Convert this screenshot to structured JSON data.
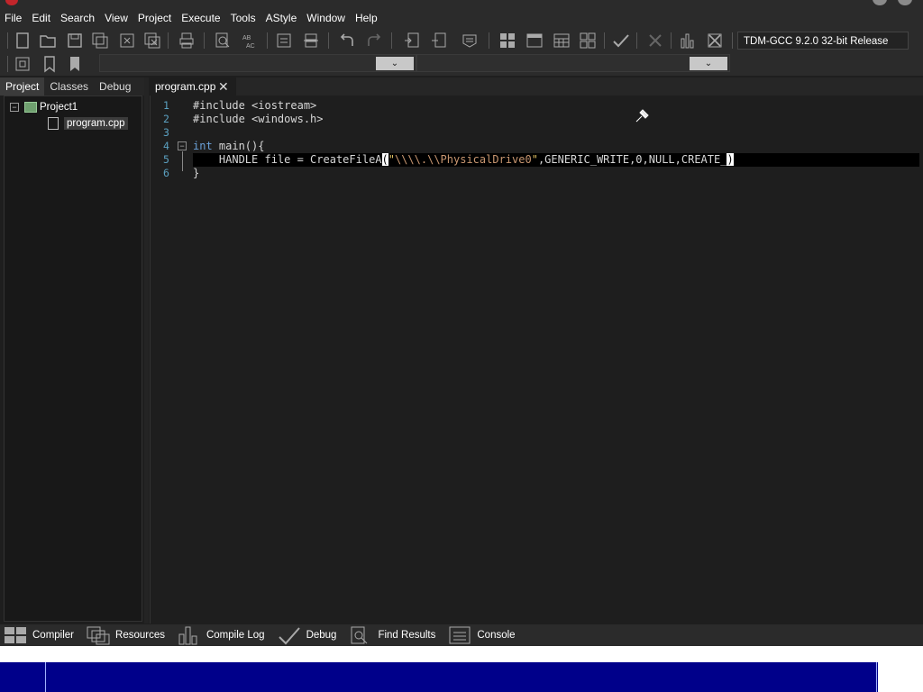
{
  "menu": [
    "File",
    "Edit",
    "Search",
    "View",
    "Project",
    "Execute",
    "Tools",
    "AStyle",
    "Window",
    "Help"
  ],
  "toolbar": {
    "compiler_selected": "TDM-GCC 9.2.0 32-bit Release"
  },
  "left_panel": {
    "tabs": [
      "Project",
      "Classes",
      "Debug"
    ],
    "active_tab": "Project",
    "project_name": "Project1",
    "file_name": "program.cpp"
  },
  "editor": {
    "tab_label": "program.cpp",
    "line_numbers": [
      "1",
      "2",
      "3",
      "4",
      "5",
      "6"
    ],
    "lines": {
      "l1": "#include <iostream>",
      "l2": "#include <windows.h>",
      "l4_kw": "int",
      "l4_rest": " main(){",
      "l5_a": "    HANDLE file = CreateFileA",
      "l5_paren": "(",
      "l5_str_quote": "\"",
      "l5_str_body": "\\\\\\\\.\\\\PhysicalDrive0",
      "l5_str_end": "\"",
      "l5_rest": ",GENERIC_WRITE,0,NULL,CREATE_",
      "l5_close": ")",
      "l6": "}"
    }
  },
  "bottom_tabs": [
    "Compiler",
    "Resources",
    "Compile Log",
    "Debug",
    "Find Results",
    "Console"
  ]
}
